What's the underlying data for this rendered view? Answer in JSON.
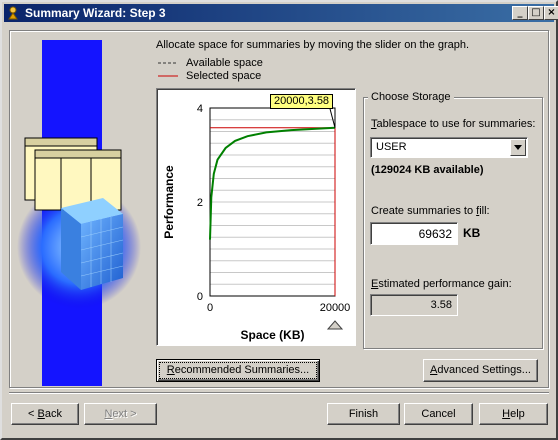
{
  "window": {
    "title": "Summary Wizard: Step 3",
    "controls": {
      "minimize": "_",
      "maximize": "□",
      "close": "×"
    }
  },
  "instruction": "Allocate space for summaries by moving the slider on the graph.",
  "legend": [
    {
      "label": "Available space",
      "color": "#333333",
      "style": "dashed"
    },
    {
      "label": "Selected space",
      "color": "#cc0000",
      "style": "solid"
    }
  ],
  "chart_data": {
    "type": "line",
    "xlabel": "Space (KB)",
    "ylabel": "Performance",
    "xlim": [
      0,
      20000
    ],
    "ylim": [
      0,
      4
    ],
    "x_ticks": [
      "0",
      "20000"
    ],
    "y_ticks": [
      "4",
      "2",
      "0"
    ],
    "series": [
      {
        "color": "#008000",
        "points": [
          [
            0,
            1.2
          ],
          [
            200,
            2.1
          ],
          [
            600,
            2.6
          ],
          [
            1200,
            2.9
          ],
          [
            2500,
            3.15
          ],
          [
            4000,
            3.3
          ],
          [
            6000,
            3.4
          ],
          [
            9000,
            3.48
          ],
          [
            13000,
            3.53
          ],
          [
            17000,
            3.56
          ],
          [
            20000,
            3.58
          ]
        ]
      }
    ],
    "selected_line": {
      "x": 20000,
      "y": 3.58,
      "color": "#cc0000"
    },
    "tooltip": "20000,3.58",
    "slider_x": 20000,
    "grid": "horizontal"
  },
  "storage": {
    "group_label": "Choose Storage",
    "tablespace_label": "Tablespace to use for summaries:",
    "tablespace_value": "USER",
    "available_text": "(129024 KB available)",
    "fill_label": "Create summaries to fill:",
    "fill_value": "69632",
    "fill_unit": "KB",
    "gain_label": "Estimated performance gain:",
    "gain_value": "3.58"
  },
  "buttons": {
    "recommended": "Recommended Summaries...",
    "advanced": "Advanced Settings...",
    "back": "Back",
    "next": "Next",
    "finish": "Finish",
    "cancel": "Cancel",
    "help": "Help"
  }
}
